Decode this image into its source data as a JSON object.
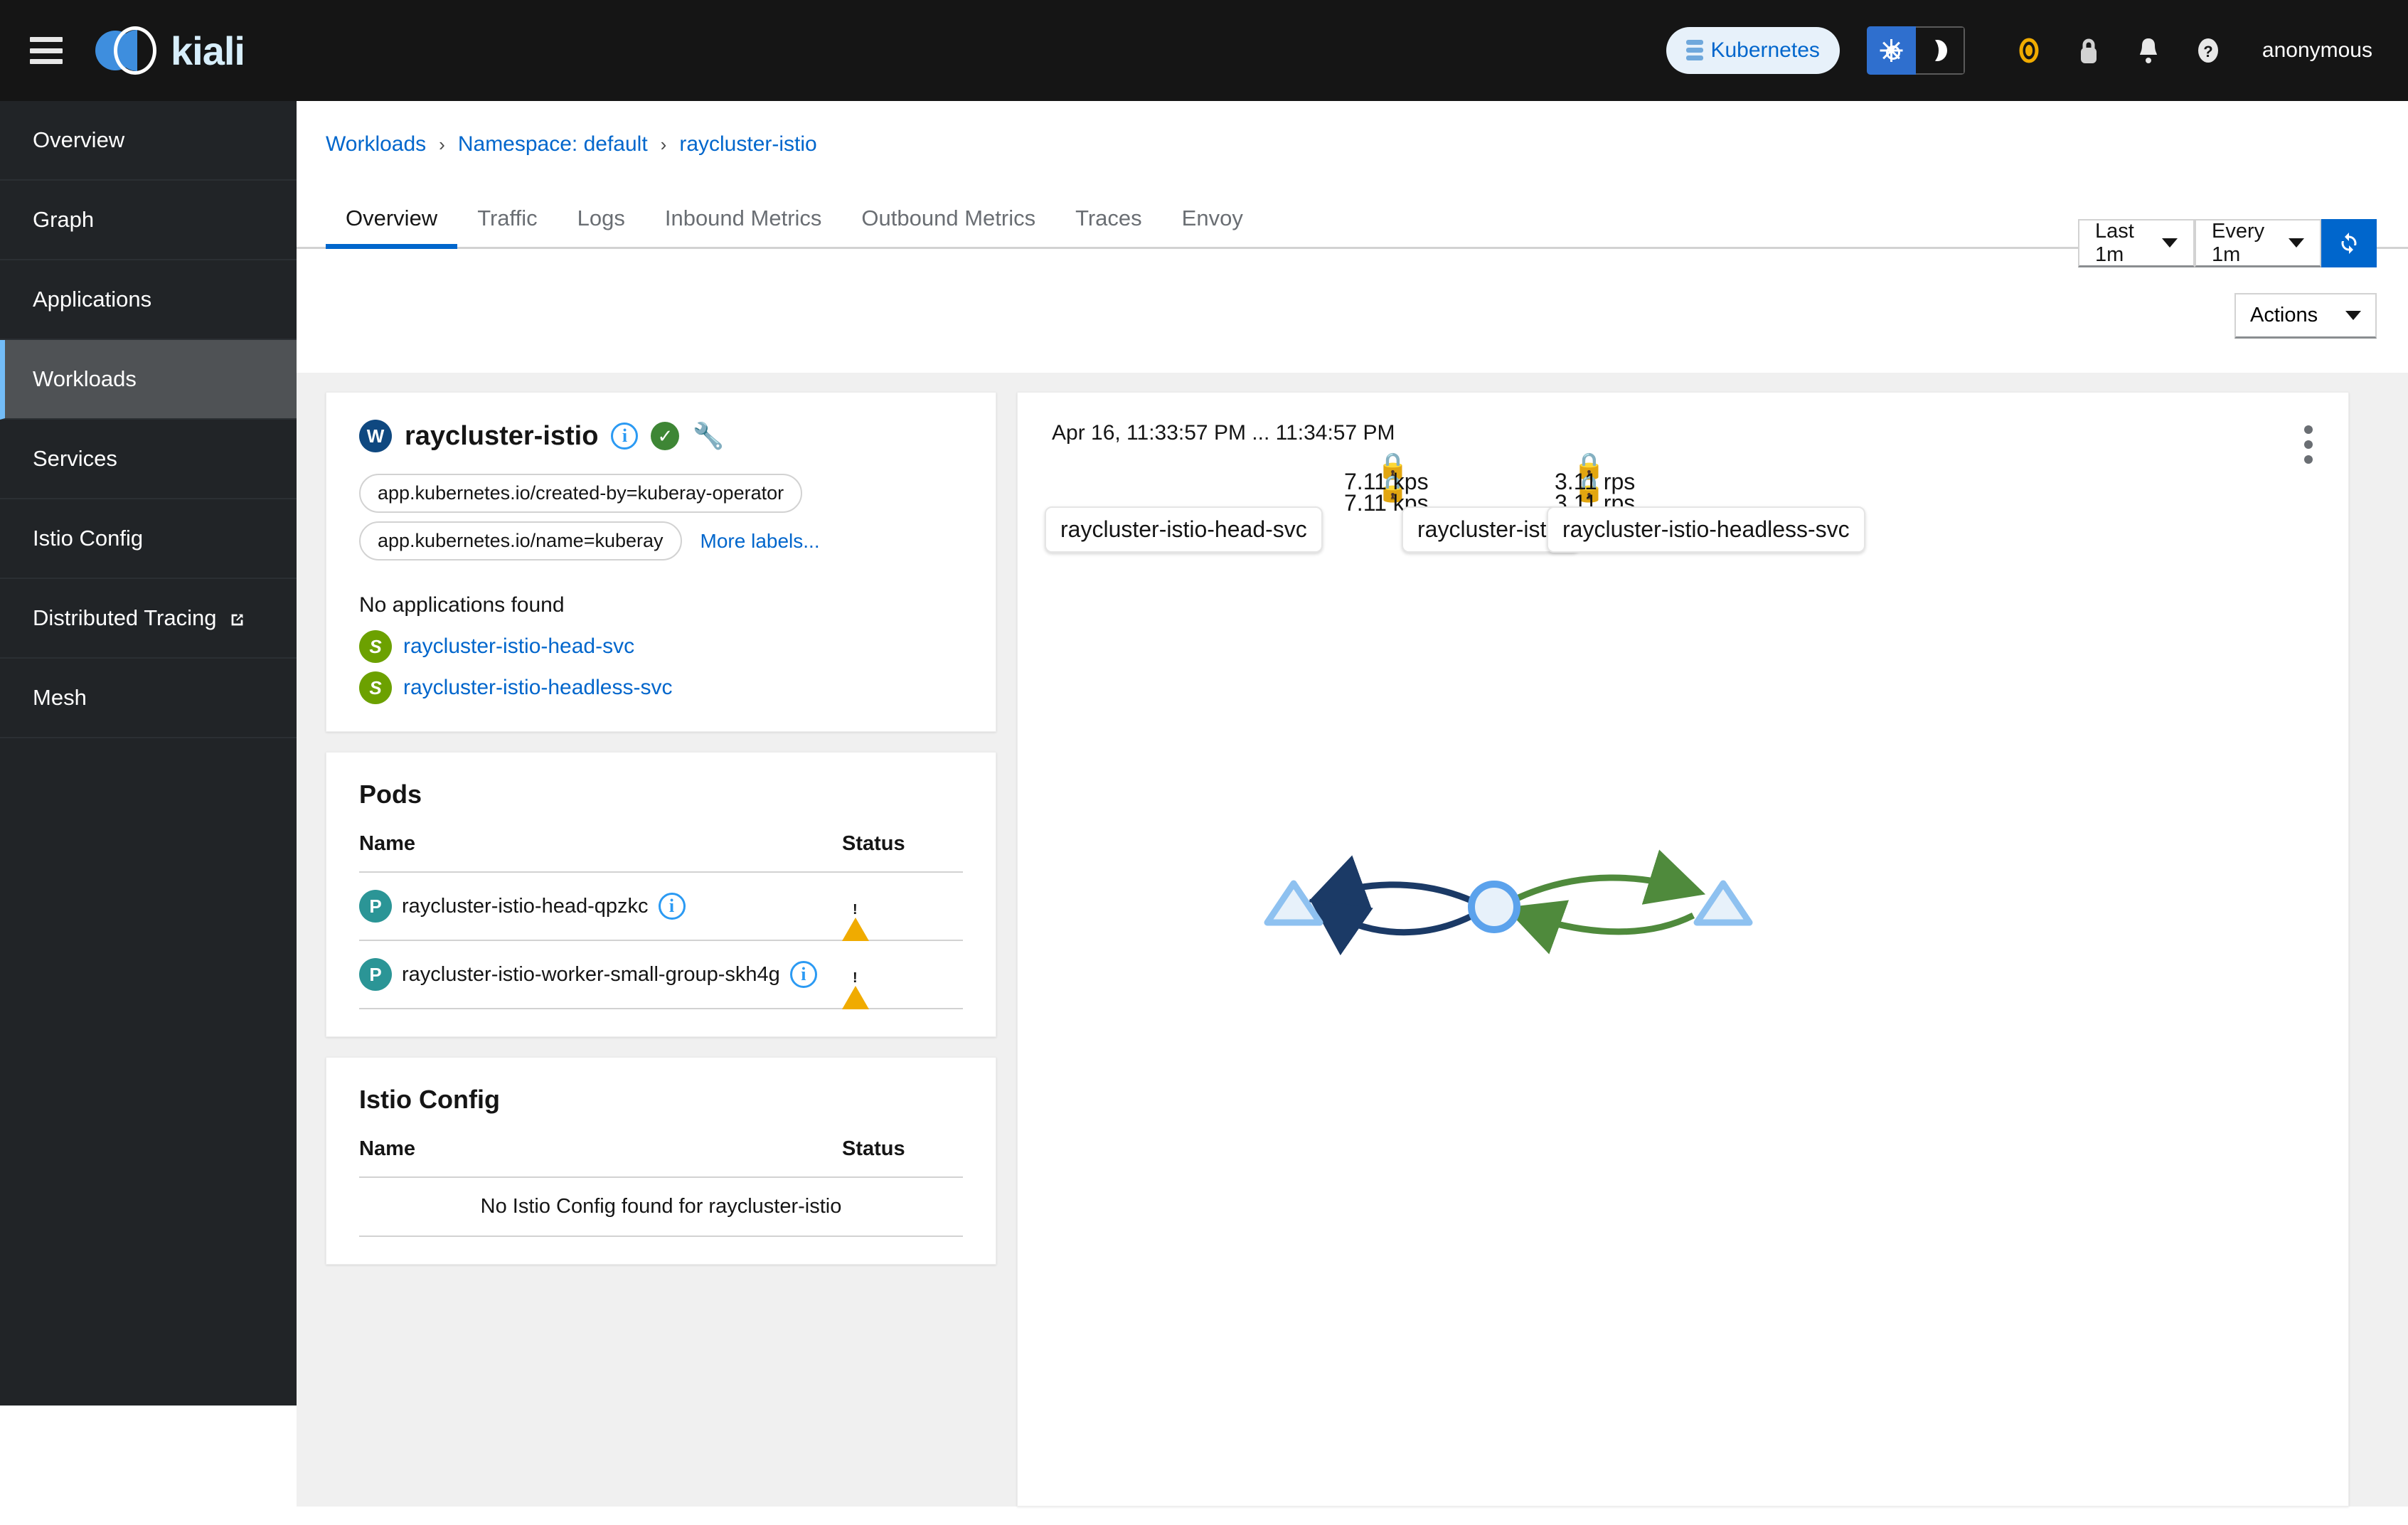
{
  "masthead": {
    "menu_icon": "hamburger-icon",
    "brand": "kiali",
    "cluster_chip": "Kubernetes",
    "theme_light_icon": "sun-icon",
    "theme_dark_icon": "moon-icon",
    "icons": [
      "istio-status-icon",
      "lock-icon",
      "bell-icon",
      "help-icon"
    ],
    "username": "anonymous"
  },
  "sidebar": {
    "items": [
      {
        "label": "Overview",
        "active": false,
        "external": false
      },
      {
        "label": "Graph",
        "active": false,
        "external": false
      },
      {
        "label": "Applications",
        "active": false,
        "external": false
      },
      {
        "label": "Workloads",
        "active": true,
        "external": false
      },
      {
        "label": "Services",
        "active": false,
        "external": false
      },
      {
        "label": "Istio Config",
        "active": false,
        "external": false
      },
      {
        "label": "Distributed Tracing",
        "active": false,
        "external": true
      },
      {
        "label": "Mesh",
        "active": false,
        "external": false
      }
    ]
  },
  "breadcrumb": {
    "items": [
      "Workloads",
      "Namespace: default",
      "raycluster-istio"
    ],
    "separator": "›"
  },
  "tabs": [
    {
      "label": "Overview",
      "active": true
    },
    {
      "label": "Traffic",
      "active": false
    },
    {
      "label": "Logs",
      "active": false
    },
    {
      "label": "Inbound Metrics",
      "active": false
    },
    {
      "label": "Outbound Metrics",
      "active": false
    },
    {
      "label": "Traces",
      "active": false
    },
    {
      "label": "Envoy",
      "active": false
    }
  ],
  "toolbar": {
    "time_range": "Last 1m",
    "refresh_interval": "Every 1m",
    "refresh_icon": "refresh-icon",
    "actions_label": "Actions"
  },
  "workload_card": {
    "badge": "W",
    "name": "raycluster-istio",
    "info_icon": "info-icon",
    "health_icon": "health-ok-icon",
    "config_icon": "wrench-icon",
    "labels": [
      "app.kubernetes.io/created-by=kuberay-operator",
      "app.kubernetes.io/name=kuberay"
    ],
    "more_labels": "More labels...",
    "no_applications": "No applications found",
    "services": [
      {
        "badge": "S",
        "name": "raycluster-istio-head-svc"
      },
      {
        "badge": "S",
        "name": "raycluster-istio-headless-svc"
      }
    ]
  },
  "pods_card": {
    "title": "Pods",
    "columns": [
      "Name",
      "Status"
    ],
    "rows": [
      {
        "badge": "P",
        "name": "raycluster-istio-head-qpzkc",
        "info_icon": "info-icon",
        "status": "warning"
      },
      {
        "badge": "P",
        "name": "raycluster-istio-worker-small-group-skh4g",
        "info_icon": "info-icon",
        "status": "warning"
      }
    ]
  },
  "istio_config_card": {
    "title": "Istio Config",
    "columns": [
      "Name",
      "Status"
    ],
    "empty_message": "No Istio Config found for raycluster-istio"
  },
  "graph_panel": {
    "timestamp": "Apr 16, 11:33:57 PM ... 11:34:57 PM",
    "kebab_icon": "kebab-menu-icon",
    "nodes": [
      {
        "id": "head-svc",
        "label": "raycluster-istio-head-svc",
        "shape": "triangle"
      },
      {
        "id": "workload",
        "label": "raycluster-istio",
        "shape": "circle"
      },
      {
        "id": "headless-svc",
        "label": "raycluster-istio-headless-svc",
        "shape": "triangle"
      }
    ],
    "edges": [
      {
        "from": "workload",
        "to": "head-svc",
        "rate": "7.11 kps",
        "color": "#1b3a66",
        "mtls_icon": "lock-icon"
      },
      {
        "from": "workload",
        "to": "head-svc",
        "rate": "7.11 kps",
        "color": "#1b3a66",
        "mtls_icon": "lock-icon"
      },
      {
        "from": "workload",
        "to": "headless-svc",
        "rate": "3.11 rps",
        "color": "#4f8a3c",
        "mtls_icon": "lock-icon"
      },
      {
        "from": "headless-svc",
        "to": "workload",
        "rate": "3.11 rps",
        "color": "#4f8a3c",
        "mtls_icon": "lock-icon"
      }
    ]
  },
  "colors": {
    "accent": "#06c",
    "masthead_bg": "#151515",
    "sidebar_bg": "#212427",
    "sidebar_active_bg": "#4f5255",
    "sidebar_active_bar": "#73bcf7",
    "content_bg": "#f0f0f0",
    "warning": "#f0ab00",
    "ok": "#3e8635",
    "danger": "#c9190b"
  }
}
